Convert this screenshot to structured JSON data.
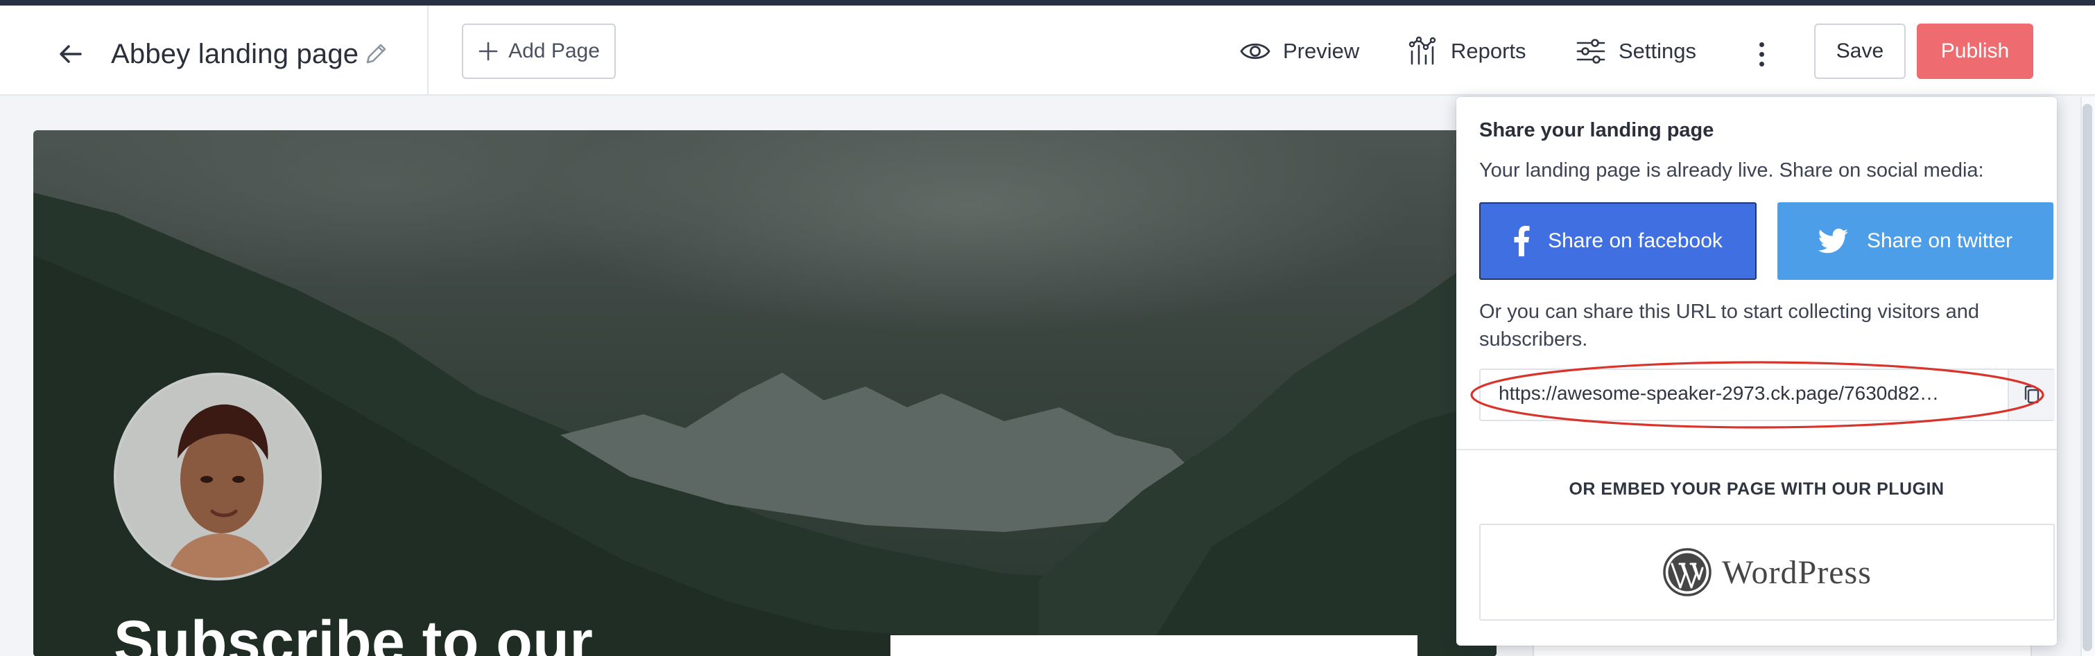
{
  "header": {
    "page_title": "Abbey landing page",
    "add_page_label": "Add Page",
    "nav": {
      "preview": "Preview",
      "reports": "Reports",
      "settings": "Settings"
    },
    "save_label": "Save",
    "publish_label": "Publish"
  },
  "canvas": {
    "heading": "Subscribe to our"
  },
  "share": {
    "title": "Share your landing page",
    "subtitle": "Your landing page is already live. Share on social media:",
    "facebook_label": "Share on facebook",
    "twitter_label": "Share on twitter",
    "url_prompt": "Or you can share this URL to start collecting visitors and subscribers.",
    "url_value": "https://awesome-speaker-2973.ck.page/7630d82…",
    "embed_heading": "OR EMBED YOUR PAGE WITH OUR PLUGIN",
    "wordpress_label": "WordPress"
  },
  "colors": {
    "publish": "#ee6b70",
    "facebook": "#3f6fe0",
    "twitter": "#4d9ee9",
    "annotation": "#d9342b",
    "top_strip": "#283044"
  },
  "icons": {
    "back": "arrow-left-icon",
    "edit": "pencil-icon",
    "add": "plus-icon",
    "preview": "eye-icon",
    "reports": "chart-icon",
    "settings": "sliders-icon",
    "more": "kebab-icon",
    "facebook": "facebook-icon",
    "twitter": "twitter-icon",
    "copy": "copy-icon",
    "wordpress": "wordpress-logo-icon"
  }
}
